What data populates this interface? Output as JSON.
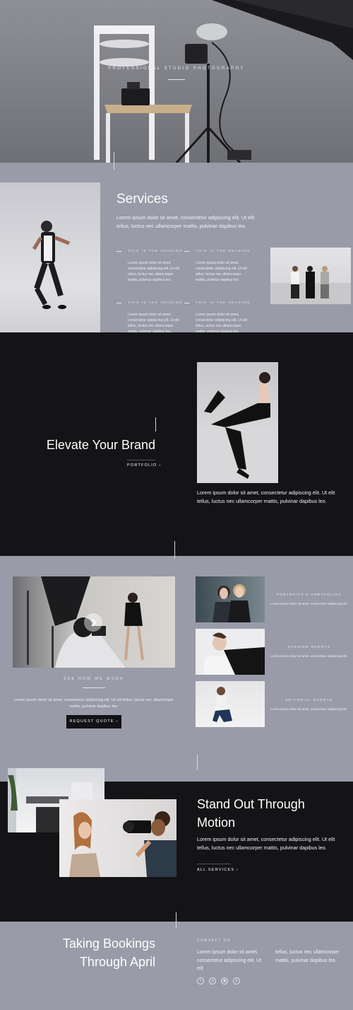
{
  "hero": {
    "kicker": "PROFESSIONAL STUDIO PHOTOGRAPHY"
  },
  "services": {
    "title": "Services",
    "intro": "Lorem ipsum dolor sit amet, consectetur adipiscing elit. Ut elit tellus, luctus nec ullamcorper mattis, pulvinar dapibus leo.",
    "items": [
      {
        "heading": "THIS IS THE HEADING",
        "text": "Lorem ipsum dolor sit amet, consectetur adipiscing elit. Ut elit tellus, luctus nec ullamcorper mattis, pulvinar dapibus leo."
      },
      {
        "heading": "THIS IS THE HEADING",
        "text": "Lorem ipsum dolor sit amet, consectetur adipiscing elit. Ut elit tellus, luctus nec ullamcorper mattis, pulvinar dapibus leo."
      },
      {
        "heading": "THIS IS THE HEADING",
        "text": "Lorem ipsum dolor sit amet, consectetur adipiscing elit. Ut elit tellus, luctus nec ullamcorper mattis, pulvinar dapibus leo."
      },
      {
        "heading": "THIS IS THE HEADING",
        "text": "Lorem ipsum dolor sit amet, consectetur adipiscing elit. Ut elit tellus, luctus nec ullamcorper mattis, pulvinar dapibus leo."
      }
    ]
  },
  "brand": {
    "title": "Elevate Your Brand",
    "link": "PORTFOLIO",
    "text": "Lorem ipsum dolor sit amet, consectetur adipiscing elit. Ut elit tellus, luctus nec ullamcorper mattis, pulvinar dapibus leo."
  },
  "work": {
    "kicker": "SEE HOW WE WORK",
    "text": "Lorem ipsum dolor sit amet, consectetur adipiscing elit. Ut elit tellus, luctus nec ullamcorper mattis, pulvinar dapibus leo.",
    "button": "REQUEST QUOTE",
    "cards": [
      {
        "title": "PORTRAITS & PORTFOLIOS",
        "text": "Lorem ipsum dolor sit amet, consectetur adipiscing elit."
      },
      {
        "title": "FASHION SHOOTS",
        "text": "Lorem ipsum dolor sit amet, consectetur adipiscing elit."
      },
      {
        "title": "EDITORIAL SHOOTS",
        "text": "Lorem ipsum dolor sit amet, consectetur adipiscing elit."
      }
    ]
  },
  "motion": {
    "title_line1": "Stand Out Through",
    "title_line2": "Motion",
    "text": "Lorem ipsum dolor sit amet, consectetur adipiscing elit. Ut elit tellus, luctus nec ullamcorper mattis, pulvinar dapibus leo.",
    "link": "ALL SERVICES"
  },
  "footer": {
    "title_line1": "Taking Bookings",
    "title_line2": "Through April",
    "contact_label": "CONTACT US",
    "col1": "Lorem ipsum dolor sit amet, consectetur adipiscing elit. Ut elit",
    "col2": "tellus, luctus nec ullamcorper mattis, pulvinar dapibus leo.",
    "social": [
      "f",
      "◎",
      "▣",
      "ʙ"
    ]
  },
  "colors": {
    "accent_bg": "#9a9ba9",
    "dark_bg": "#141316"
  }
}
